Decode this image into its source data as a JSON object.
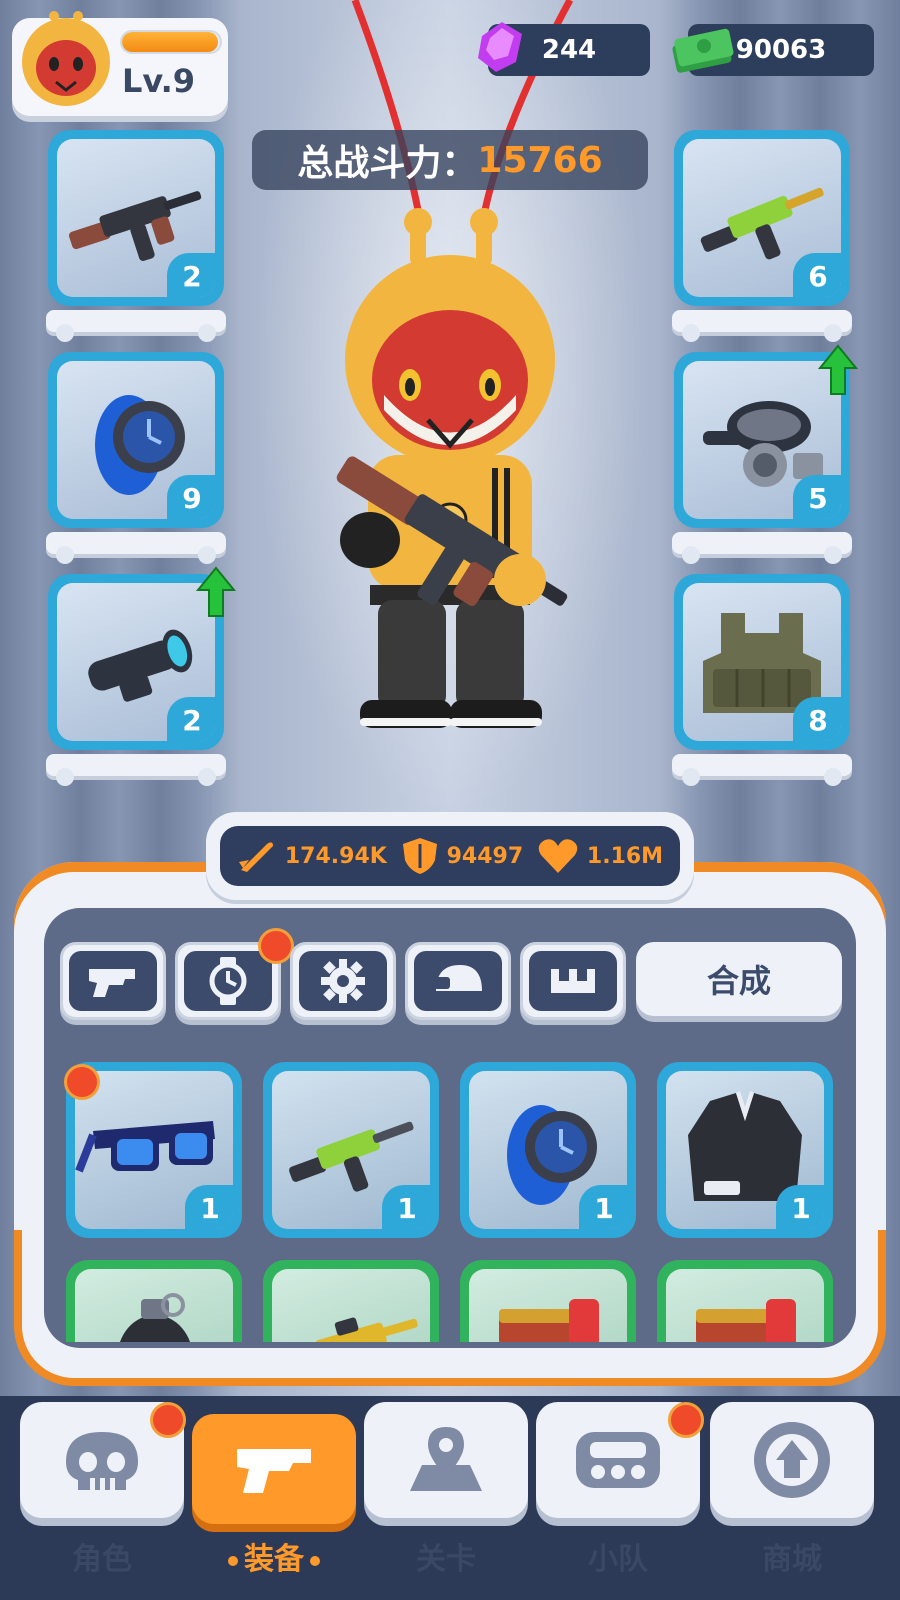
{
  "player": {
    "level": "Lv.9",
    "xp_fraction": 0.98
  },
  "currency": {
    "gems": "244",
    "cash": "90063"
  },
  "power": {
    "label": "总战斗力：",
    "value": "15766"
  },
  "left_slots": [
    {
      "icon": "assault-rifle-icon",
      "count": "2"
    },
    {
      "icon": "wristwatch-icon",
      "count": "9"
    },
    {
      "icon": "scope-icon",
      "count": "2",
      "upgradable": true
    }
  ],
  "right_slots": [
    {
      "icon": "green-rifle-icon",
      "count": "6"
    },
    {
      "icon": "gas-mask-icon",
      "count": "5",
      "upgradable": true
    },
    {
      "icon": "armor-vest-icon",
      "count": "8"
    }
  ],
  "stats": {
    "attack": "174.94K",
    "defense": "94497",
    "health": "1.16M"
  },
  "tabs": [
    {
      "icon": "gun-tab-icon"
    },
    {
      "icon": "watch-tab-icon",
      "badge": true
    },
    {
      "icon": "gear-tab-icon"
    },
    {
      "icon": "helmet-tab-icon"
    },
    {
      "icon": "base-tab-icon"
    }
  ],
  "merge_label": "合成",
  "inventory": [
    {
      "icon": "sunglasses-icon",
      "count": "1",
      "rarity": "blue",
      "badge": true
    },
    {
      "icon": "green-rifle-icon",
      "count": "1",
      "rarity": "blue"
    },
    {
      "icon": "wristwatch-icon",
      "count": "1",
      "rarity": "blue"
    },
    {
      "icon": "suit-jacket-icon",
      "count": "1",
      "rarity": "blue"
    },
    {
      "icon": "grenade-icon",
      "count": "",
      "rarity": "green"
    },
    {
      "icon": "gold-rifle-icon",
      "count": "",
      "rarity": "green"
    },
    {
      "icon": "red-pistol-icon",
      "count": "",
      "rarity": "green"
    },
    {
      "icon": "red-pistol-icon",
      "count": "",
      "rarity": "green"
    }
  ],
  "nav": [
    {
      "label": "角色",
      "icon": "skull-icon",
      "badge": true
    },
    {
      "label": "装备",
      "icon": "gun-icon",
      "active": true
    },
    {
      "label": "关卡",
      "icon": "map-pin-icon"
    },
    {
      "label": "小队",
      "icon": "controller-icon",
      "badge": true
    },
    {
      "label": "商城",
      "icon": "shop-icon"
    }
  ],
  "colors": {
    "accent": "#ff9a2a",
    "slot_blue": "#2ea7d9",
    "slot_green": "#31b35e",
    "dark": "#2d3d5c"
  }
}
